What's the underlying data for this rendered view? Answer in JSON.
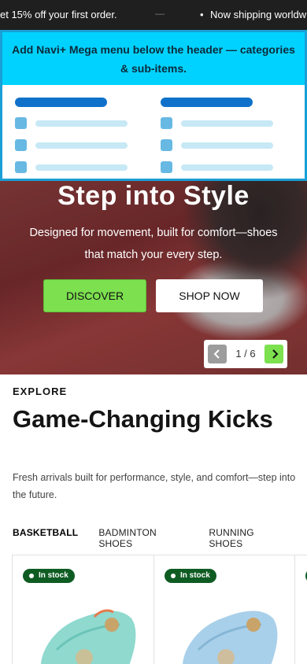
{
  "announcement": {
    "message_1": "et 15% off your first order.",
    "separator": "—",
    "bullet": "•",
    "message_2": "Now shipping worldw"
  },
  "mega_menu": {
    "banner_text": "Add Navi+ Mega menu below the header — categories & sub-items."
  },
  "hero": {
    "title": "Step into Style",
    "subtitle": "Designed for movement, built for comfort—shoes that match your every step.",
    "primary_button": "DISCOVER",
    "secondary_button": "SHOP NOW",
    "pager": "1 / 6"
  },
  "explore": {
    "eyebrow": "EXPLORE",
    "heading": "Game-Changing Kicks",
    "description": "Fresh arrivals built for performance, style, and comfort—step into the future.",
    "tabs": [
      "BASKETBALL",
      "BADMINTON SHOES",
      "RUNNING SHOES"
    ]
  },
  "products": [
    {
      "badge": "In stock",
      "color": "#8fd9cf"
    },
    {
      "badge": "In stock",
      "color": "#a9d0ea"
    }
  ],
  "colors": {
    "accent_green": "#7ce04f",
    "mega_border": "#1a9fd6",
    "mega_banner": "#00d2ff",
    "stock_badge": "#0f5c23"
  }
}
